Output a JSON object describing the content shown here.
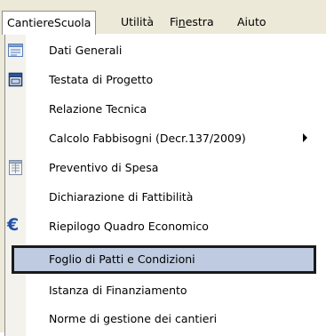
{
  "menubar": {
    "items": [
      {
        "label": "CantiereScuola",
        "active": true
      },
      {
        "label": "Utilità",
        "active": false
      },
      {
        "mnemonic_before": "Fi",
        "mnemonic": "n",
        "mnemonic_after": "estra",
        "label": "Finestra",
        "active": false
      },
      {
        "label": "Aiuto",
        "active": false
      }
    ]
  },
  "dropdown": {
    "items": [
      {
        "label": "Dati Generali",
        "icon": "form-icon"
      },
      {
        "label": "Testata di Progetto",
        "icon": "document-icon"
      },
      {
        "label": "Relazione Tecnica",
        "icon": ""
      },
      {
        "label": "Calcolo Fabbisogni (Decr.137/2009)",
        "icon": "",
        "submenu": true
      },
      {
        "label": "Preventivo di Spesa",
        "icon": "spreadsheet-icon"
      },
      {
        "label": "Dichiarazione di Fattibilità",
        "icon": ""
      },
      {
        "label": "Riepilogo Quadro Economico",
        "icon": "euro-icon"
      },
      {
        "label": "Foglio di Patti e Condizioni",
        "icon": "",
        "selected": true
      },
      {
        "label": "Istanza di Finanziamento",
        "icon": ""
      },
      {
        "label": "Norme di gestione dei cantieri",
        "icon": ""
      }
    ]
  },
  "colors": {
    "menubar_bg": "#ece9d8",
    "selection_bg": "#bfcbe0",
    "selection_border": "#1a1a1a",
    "euro_blue": "#1f4fa8"
  }
}
